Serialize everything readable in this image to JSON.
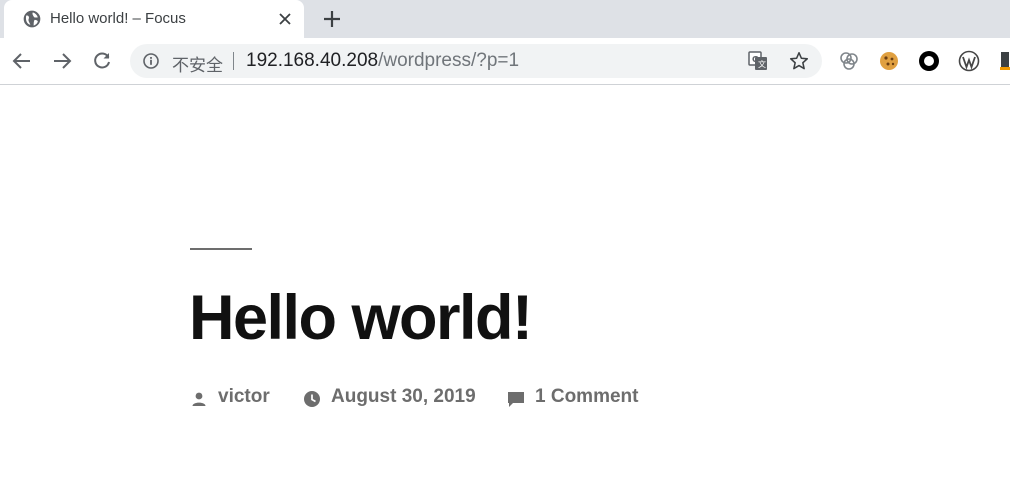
{
  "tab": {
    "title": "Hello world! – Focus",
    "favicon_icon": "globe-icon"
  },
  "toolbar": {
    "insecure_label": "不安全",
    "url_host": "192.168.40.208",
    "url_path": "/wordpress/?p=1"
  },
  "extensions": [
    {
      "icon": "extension-circles-icon"
    },
    {
      "icon": "cookie-icon"
    },
    {
      "icon": "ring-icon"
    },
    {
      "icon": "wordpress-icon"
    },
    {
      "icon": "partial-extension-icon"
    }
  ],
  "post": {
    "title": "Hello world!",
    "author": "victor",
    "date": "August 30, 2019",
    "comments": "1 Comment"
  },
  "colors": {
    "tabstrip_bg": "#dee1e6",
    "omnibox_bg": "#f1f3f4",
    "title_color": "#111111",
    "meta_color": "#6d6d6d"
  }
}
